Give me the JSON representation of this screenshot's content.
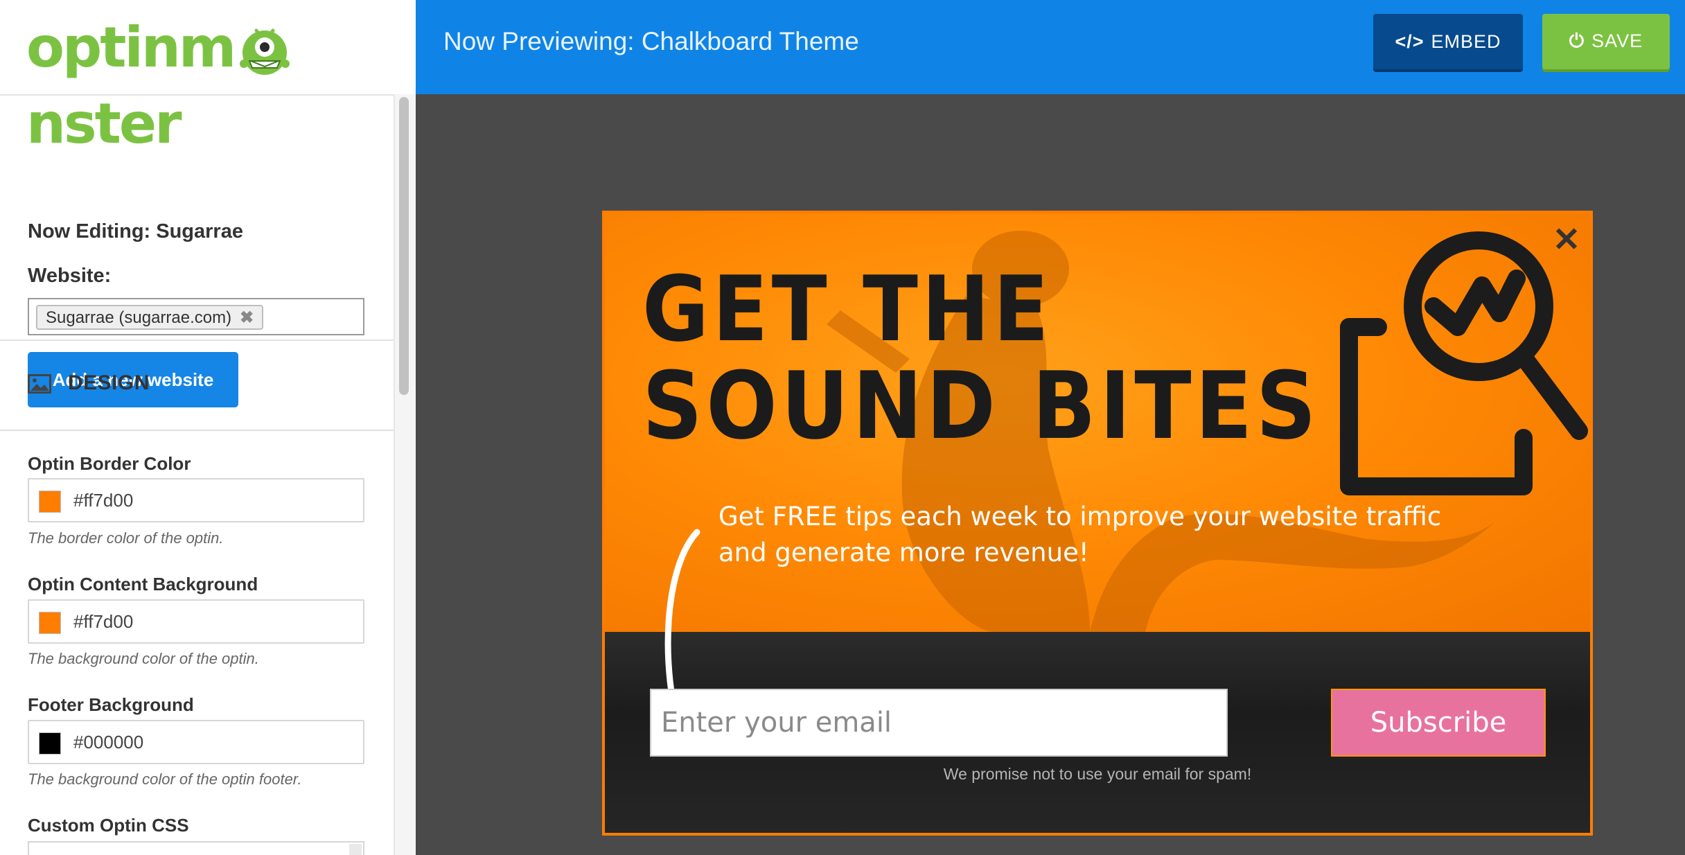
{
  "header": {
    "logo_text_left": "optinm",
    "logo_text_right": "nster",
    "preview_title": "Now Previewing: Chalkboard Theme",
    "embed_label": "EMBED",
    "embed_icon": "code-icon",
    "save_label": "SAVE",
    "save_icon": "power-icon"
  },
  "sidebar": {
    "editing_title": "Now Editing: Sugarrae",
    "website_label": "Website:",
    "website_tag": "Sugarrae (sugarrae.com)",
    "website_tag_remove": "✖",
    "add_website_label": "Add a new website",
    "design_label": "DESIGN",
    "fields": [
      {
        "label": "Optin Border Color",
        "value": "#ff7d00",
        "swatch": "#ff7d00",
        "help": "The border color of the optin."
      },
      {
        "label": "Optin Content Background",
        "value": "#ff7d00",
        "swatch": "#ff7d00",
        "help": "The background color of the optin."
      },
      {
        "label": "Footer Background",
        "value": "#000000",
        "swatch": "#000000",
        "help": "The background color of the optin footer."
      }
    ],
    "custom_css_label": "Custom Optin CSS"
  },
  "optin": {
    "headline_line1": "GET THE",
    "headline_line2": "SOUND BITES",
    "close_symbol": "✕",
    "tagline": "Get FREE tips each week to improve your website traffic and generate more revenue!",
    "email_placeholder": "Enter your email",
    "subscribe_label": "Subscribe",
    "spam_note": "We promise not to use your email for spam!"
  },
  "colors": {
    "brand_blue": "#0f84e6",
    "embed_dark": "#074a8e",
    "save_green": "#7cc242",
    "optin_orange": "#ff7d00",
    "subscribe_pink": "#e8729e"
  }
}
